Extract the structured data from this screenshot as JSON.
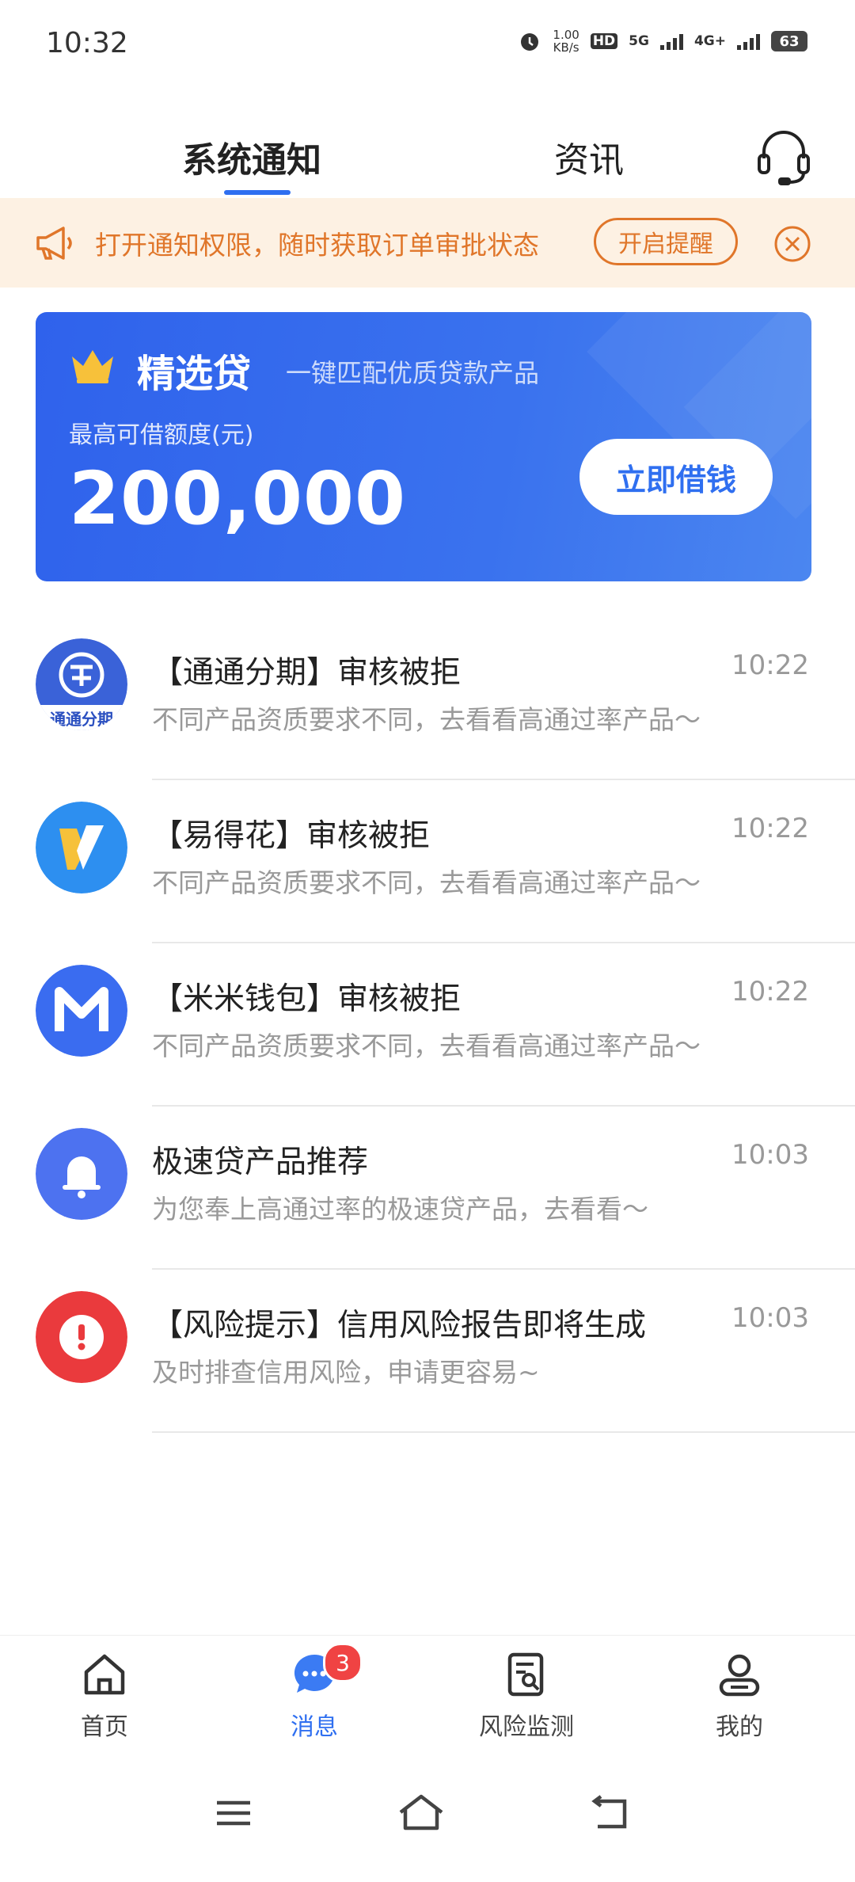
{
  "status_bar": {
    "time": "10:32",
    "speed_value": "1.00",
    "speed_unit": "KB/s",
    "hd_label": "HD",
    "sig_5g": "5G",
    "sig_4g": "4G+",
    "battery": "63"
  },
  "tabs": {
    "active": "系统通知",
    "news": "资讯"
  },
  "notify_banner": {
    "text": "打开通知权限，随时获取订单审批状态",
    "button": "开启提醒"
  },
  "loan_card": {
    "title": "精选贷",
    "subtitle": "一键匹配优质贷款产品",
    "label": "最高可借额度(元)",
    "amount": "200,000",
    "button": "立即借钱"
  },
  "messages": [
    {
      "title": "【通通分期】审核被拒",
      "time": "10:22",
      "desc": "不同产品资质要求不同，去看看高通过率产品～",
      "avatar_text": "通通分期"
    },
    {
      "title": "【易得花】审核被拒",
      "time": "10:22",
      "desc": "不同产品资质要求不同，去看看高通过率产品～"
    },
    {
      "title": "【米米钱包】审核被拒",
      "time": "10:22",
      "desc": "不同产品资质要求不同，去看看高通过率产品～"
    },
    {
      "title": "极速贷产品推荐",
      "time": "10:03",
      "desc": "为您奉上高通过率的极速贷产品，去看看～"
    },
    {
      "title": "【风险提示】信用风险报告即将生成",
      "time": "10:03",
      "desc": "及时排查信用风险，申请更容易~"
    }
  ],
  "bottom_nav": {
    "home": "首页",
    "messages": "消息",
    "messages_badge": "3",
    "risk": "风险监测",
    "mine": "我的"
  },
  "colors": {
    "accent": "#2f6ff0",
    "banner_orange": "#e0762a",
    "banner_bg": "#fdf1e3",
    "badge_red": "#f04343"
  }
}
